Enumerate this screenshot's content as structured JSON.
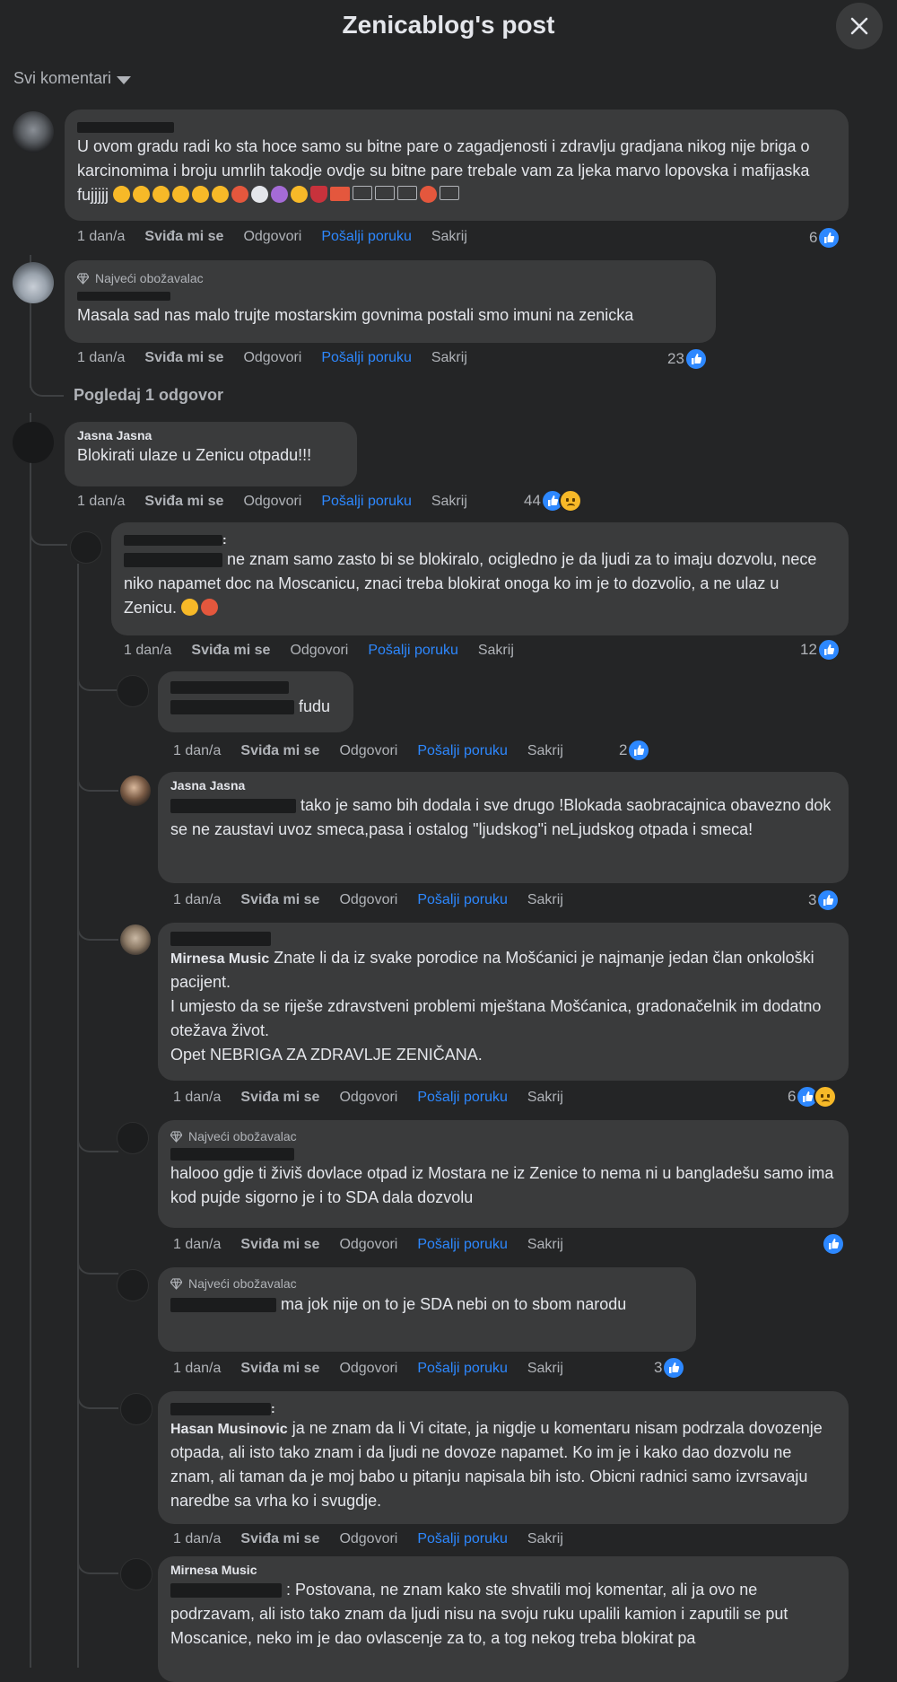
{
  "header": {
    "title": "Zenicablog's post"
  },
  "sort": {
    "label": "Svi komentari"
  },
  "common": {
    "time": "1 dan/a",
    "like": "Sviđa mi se",
    "reply": "Odgovori",
    "send_message": "Pošalji poruku",
    "hide": "Sakrij",
    "top_fan": "Najveći obožavalac"
  },
  "comments": [
    {
      "text": "U ovom gradu radi ko sta hoce samo su bitne pare o zagadjenosti i zdravlju gradjana nikog nije briga o karcinomima i broju umrlih takodje ovdje su bitne pare trebale vam za ljeka marvo lopovska i mafijaska fujjjjj",
      "reactions": "6"
    },
    {
      "text": "Masala sad nas malo trujte mostarskim govnima postali smo imuni na zenicka",
      "reactions": "23"
    },
    {
      "name": "Jasna Jasna",
      "text": "Blokirati ulaze u Zenicu otpadu!!!",
      "reactions": "44"
    }
  ],
  "view_replies": "Pogledaj 1 odgovor",
  "replies": [
    {
      "name_suffix": ":",
      "text_first": "ne znam samo zasto bi se blokiralo, ocigledno je da ljudi za to imaju",
      "text_rest": "dozvolu, nece niko napamet doc na Moscanicu, znaci treba blokirat onoga ko im je to dozvolio, a ne ulaz u Zenicu.",
      "reactions": "12"
    },
    {
      "text_first": "fudu",
      "reactions": "2"
    },
    {
      "name": "Jasna Jasna",
      "text_first": "tako je samo bih dodala i sve drugo !Blokada saobracajnica",
      "text_rest": "obavezno dok se ne zaustavi uvoz smeca,pasa i ostalog \"ljudskog\"i neLjudskog otpada i smeca!",
      "reactions": "3"
    },
    {
      "tag": "Mirnesa Music",
      "text_first": "Znate li da iz svake porodice na Mošćanici je najmanje jedan član",
      "text_rest": "onkološki pacijent.",
      "para2": "I umjesto da se riješe zdravstveni problemi mještana Mošćanica, gradonačelnik im dodatno otežava život.",
      "para3": "Opet NEBRIGA ZA ZDRAVLJE ZENIČANA.",
      "reactions": "6"
    },
    {
      "text_first": "halooo gdje ti živiš dovlace otpad iz Mostara ne iz Zenice to nema",
      "text_rest": "ni u bangladešu samo ima kod pujde sigorno je i to SDA dala dozvolu"
    },
    {
      "text_first": "ma jok nije on to je SDA nebi on to sbom narodu",
      "reactions": "3"
    },
    {
      "name_suffix": ":",
      "tag": "Hasan Musinovic",
      "text_first": "ja ne znam da li Vi citate, ja nigdje u komentaru nisam podrzala",
      "text_rest": "dovozenje otpada, ali isto tako znam i da ljudi ne dovoze napamet. Ko im je i kako dao dozvolu ne znam, ali taman da je moj babo u pitanju napisala bih isto. Obicni radnici samo izvrsavaju naredbe sa vrha ko i svugdje."
    },
    {
      "name": "Mirnesa Music",
      "text_first": ": Postovana, ne znam kako ste shvatili moj komentar, ali ja ovo ne",
      "text_rest": "podrzavam, ali isto tako znam da ljudi nisu na svoju ruku upalili kamion i zaputili se put Moscanice, neko im je dao ovlascenje za to, a tog nekog treba blokirat pa"
    }
  ],
  "colors": {
    "background": "#242526",
    "bubble": "#3a3b3c",
    "link": "#2d88ff",
    "muted": "#b0b3b8"
  }
}
